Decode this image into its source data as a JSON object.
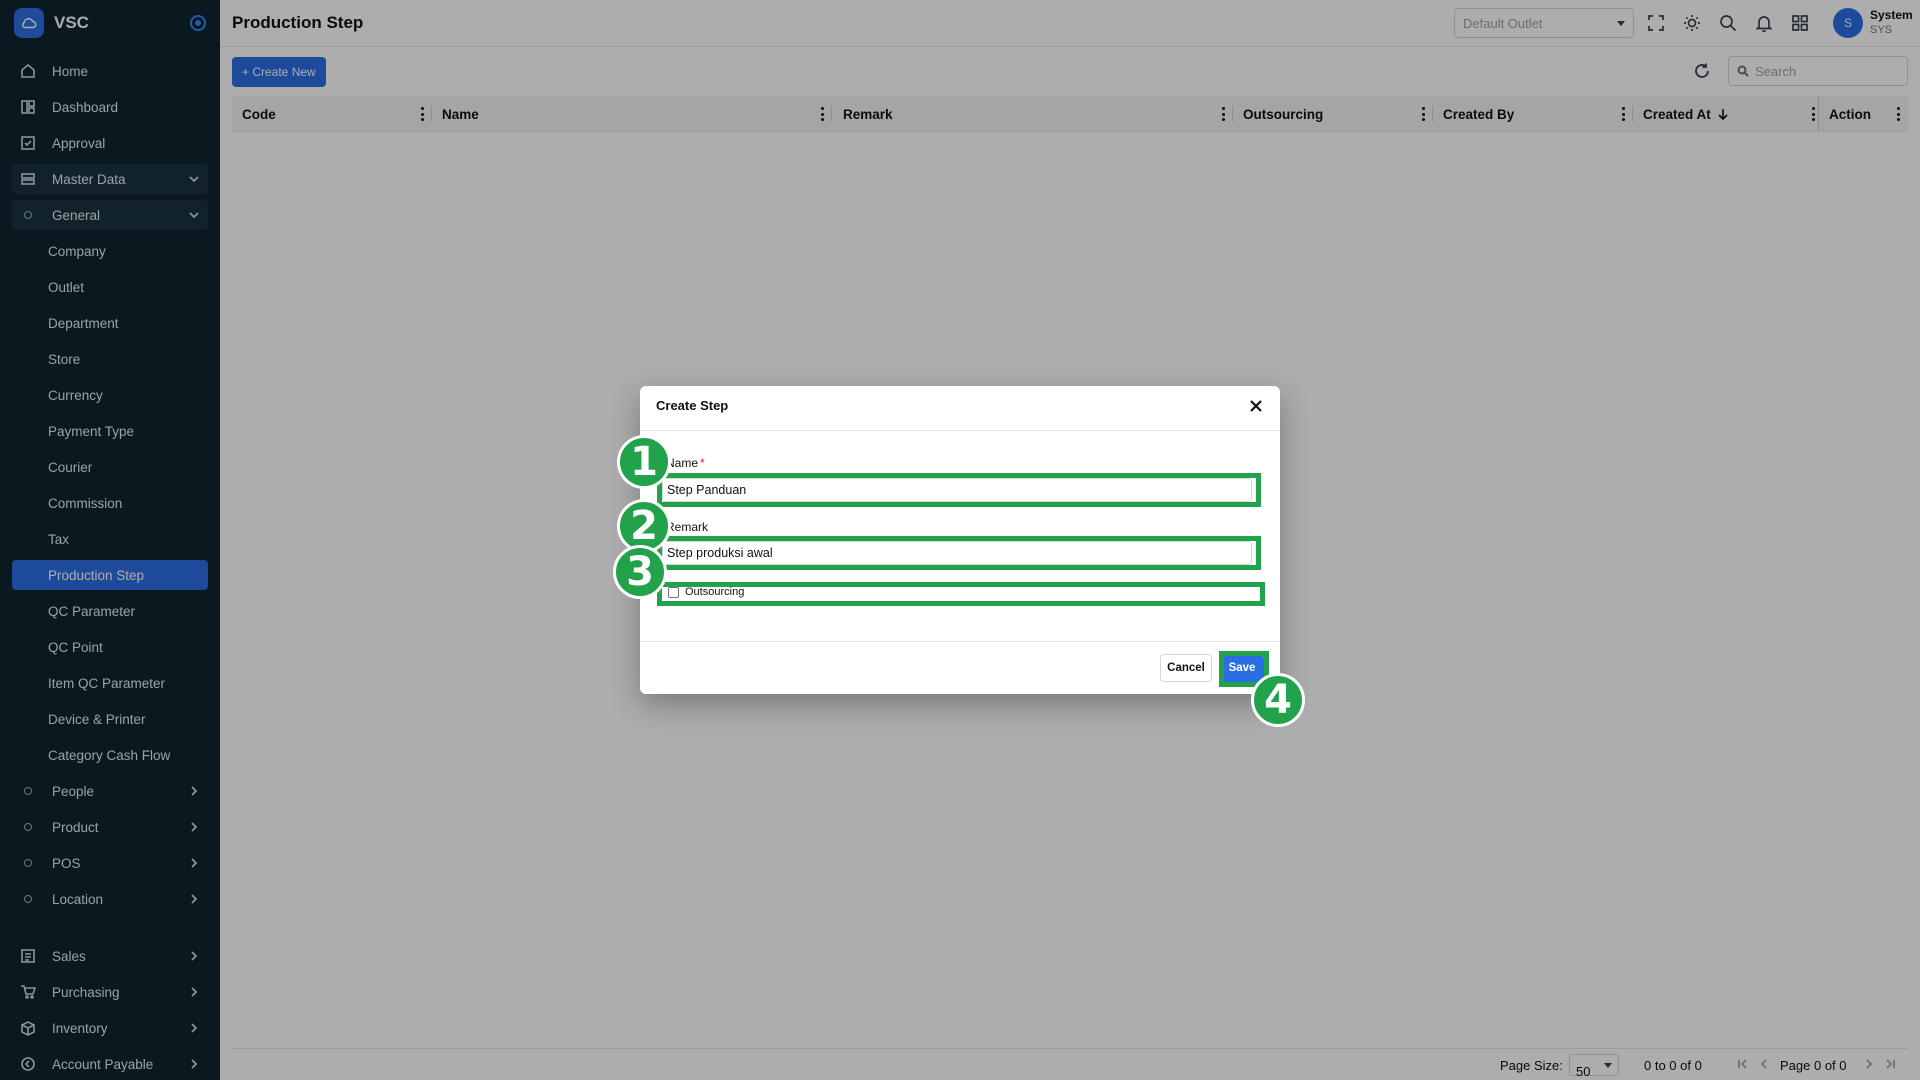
{
  "app": {
    "brand": "VSC"
  },
  "sidebar": {
    "items": [
      {
        "label": "Home",
        "icon": "home-icon"
      },
      {
        "label": "Dashboard",
        "icon": "dashboard-icon"
      },
      {
        "label": "Approval",
        "icon": "approval-icon"
      },
      {
        "label": "Master Data",
        "icon": "database-icon"
      },
      {
        "label": "General",
        "icon": "circle-icon"
      },
      {
        "label": "Company"
      },
      {
        "label": "Outlet"
      },
      {
        "label": "Department"
      },
      {
        "label": "Store"
      },
      {
        "label": "Currency"
      },
      {
        "label": "Payment Type"
      },
      {
        "label": "Courier"
      },
      {
        "label": "Commission"
      },
      {
        "label": "Tax"
      },
      {
        "label": "Production Step"
      },
      {
        "label": "QC Parameter"
      },
      {
        "label": "QC Point"
      },
      {
        "label": "Item QC Parameter"
      },
      {
        "label": "Device & Printer"
      },
      {
        "label": "Category Cash Flow"
      },
      {
        "label": "People",
        "icon": "circle-icon"
      },
      {
        "label": "Product",
        "icon": "circle-icon"
      },
      {
        "label": "POS",
        "icon": "circle-icon"
      },
      {
        "label": "Location",
        "icon": "circle-icon"
      },
      {
        "label": "Sales",
        "icon": "sales-icon"
      },
      {
        "label": "Purchasing",
        "icon": "cart-icon"
      },
      {
        "label": "Inventory",
        "icon": "box-icon"
      },
      {
        "label": "Account Payable",
        "icon": "payable-icon"
      }
    ]
  },
  "header": {
    "title": "Production Step",
    "outlet_placeholder": "Default Outlet",
    "user_name": "System",
    "user_code": "SYS",
    "avatar_initial": "S"
  },
  "toolbar": {
    "create_label": "+ Create New",
    "search_placeholder": "Search"
  },
  "table": {
    "columns": [
      "Code",
      "Name",
      "Remark",
      "Outsourcing",
      "Created By",
      "Created At",
      "Action"
    ]
  },
  "footer": {
    "page_size_label": "Page Size:",
    "page_size_value": "50",
    "range_text": "0 to 0 of 0",
    "page_text": "Page 0 of 0"
  },
  "modal": {
    "title": "Create Step",
    "name_label": "Name",
    "name_required": "*",
    "name_value": "Step Panduan",
    "remark_label": "Remark",
    "remark_value": "Step produksi awal",
    "outsourcing_label": "Outsourcing",
    "cancel_label": "Cancel",
    "save_label": "Save"
  },
  "annotations": [
    "1",
    "2",
    "3",
    "4"
  ],
  "colors": {
    "sidebar_bg": "#0f2530",
    "accent": "#2b6ee3",
    "highlight": "#22a24a"
  }
}
